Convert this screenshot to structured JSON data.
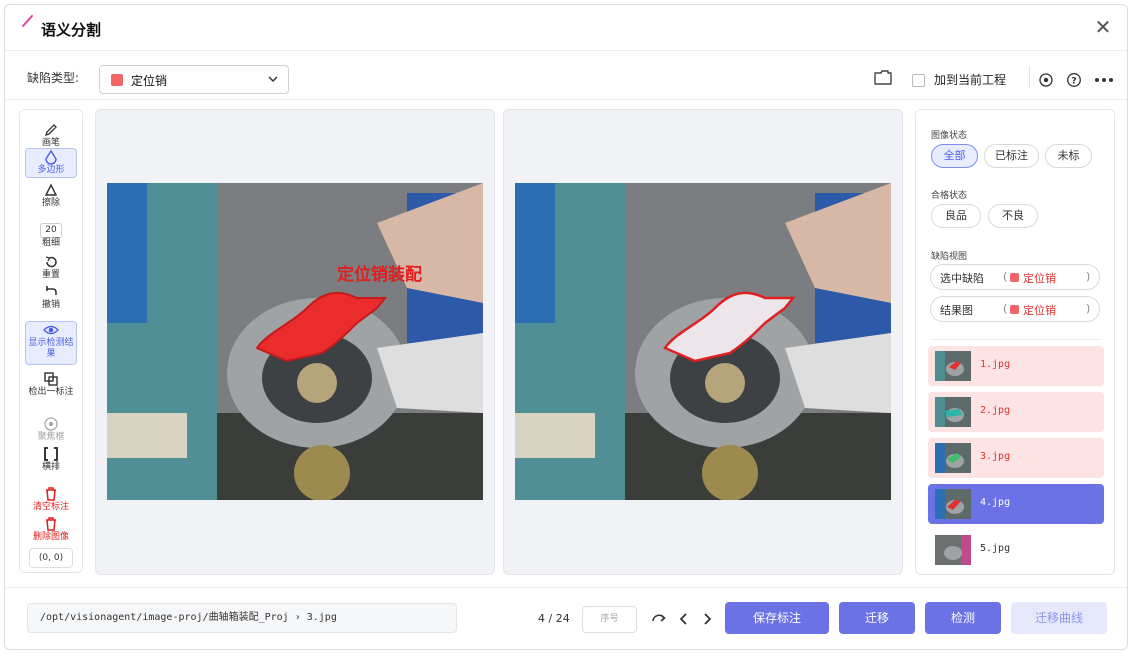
{
  "dialog": {
    "title": "语义分割"
  },
  "toolbar": {
    "defect_type_label": "缺陷类型:",
    "defect_selected": "定位销",
    "defect_color": "#f06565",
    "add_to_project_label": "加到当前工程"
  },
  "tools": {
    "brush": "画笔",
    "polygon": "多边形",
    "erase": "擦除",
    "thickness_value": "20",
    "thickness": "粗细",
    "reset": "重置",
    "undo": "撤销",
    "show_result": "显示检测结果",
    "detect_one": "检出一标注",
    "focus": "聚焦框",
    "horizontal": "横排",
    "clear_labels": "清空标注",
    "delete_image": "删除图像",
    "coords": "(0, 0)"
  },
  "canvas": {
    "annotation_label": "定位销装配",
    "annotation_color": "#e02020"
  },
  "right_panel": {
    "image_status_title": "图像状态",
    "image_status_options": [
      "全部",
      "已标注",
      "未标"
    ],
    "image_status_selected": "全部",
    "quality_title": "合格状态",
    "quality_options": [
      "良品",
      "不良"
    ],
    "defect_view_title": "缺陷视图",
    "views": [
      {
        "label": "选中缺陷",
        "value": "定位销",
        "paren_l": "(",
        "paren_r": ")"
      },
      {
        "label": "结果图",
        "value": "定位销",
        "paren_l": "(",
        "paren_r": ")"
      }
    ],
    "files": [
      {
        "name": "1.jpg",
        "state": "flagged"
      },
      {
        "name": "2.jpg",
        "state": "flagged"
      },
      {
        "name": "3.jpg",
        "state": "flagged"
      },
      {
        "name": "4.jpg",
        "state": "current"
      },
      {
        "name": "5.jpg",
        "state": "plain"
      }
    ]
  },
  "footer": {
    "path": "/opt/visionagent/image-proj/曲轴箱装配_Proj › 3.jpg",
    "pager": "4 / 24",
    "seq_placeholder": "序号",
    "save_label": "保存标注",
    "migrate_label": "迁移",
    "detect_label": "检测",
    "migrate_curve_label": "迁移曲线"
  }
}
